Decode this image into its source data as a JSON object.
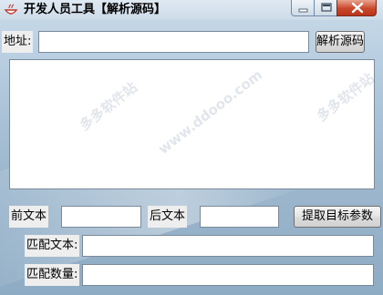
{
  "window": {
    "title": "开发人员工具【解析源码】"
  },
  "address": {
    "label": "地址:",
    "value": "",
    "parse_button": "解析源码"
  },
  "source_area": {
    "value": ""
  },
  "extract_row": {
    "prefix_label": "前文本",
    "prefix_value": "",
    "suffix_label": "后文本",
    "suffix_value": "",
    "extract_button": "提取目标参数"
  },
  "results": {
    "match_text_label": "匹配文本:",
    "match_text_value": "",
    "match_count_label": "匹配数量:",
    "match_count_value": ""
  },
  "watermark": {
    "site": "多多软件站",
    "url": "www.ddooo.com"
  },
  "colors": {
    "close_button": "#c9472b",
    "window_bg": "#9fb9cf",
    "label_bg": "#eeeeee"
  },
  "icons": {
    "app": "bowl-icon",
    "minimize": "minimize-icon",
    "maximize": "maximize-icon",
    "close": "close-icon"
  }
}
